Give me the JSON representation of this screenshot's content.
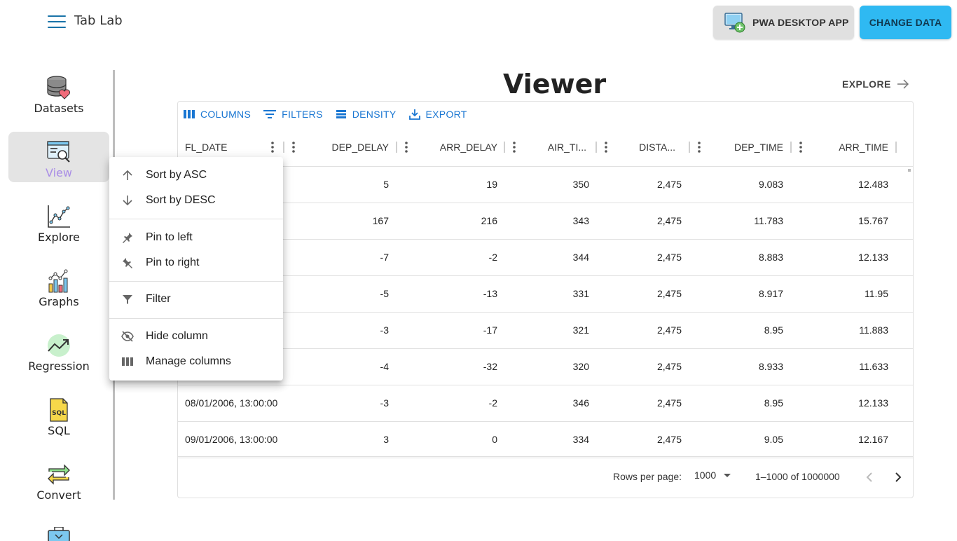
{
  "app": {
    "title": "Tab Lab"
  },
  "header": {
    "pwa_label": "PWA DESKTOP APP",
    "change_label": "CHANGE DATA"
  },
  "sidebar": {
    "items": [
      {
        "label": "Datasets",
        "icon": "database-heart-icon",
        "active": false
      },
      {
        "label": "View",
        "icon": "monitor-search-icon",
        "active": true
      },
      {
        "label": "Explore",
        "icon": "line-chart-icon",
        "active": false
      },
      {
        "label": "Graphs",
        "icon": "bar-chart-icon",
        "active": false
      },
      {
        "label": "Regression",
        "icon": "trend-arrow-icon",
        "active": false
      },
      {
        "label": "SQL",
        "icon": "sql-file-icon",
        "active": false
      },
      {
        "label": "Convert",
        "icon": "convert-arrows-icon",
        "active": false
      }
    ]
  },
  "main": {
    "title": "Viewer",
    "explore_link": "EXPLORE"
  },
  "toolbar": {
    "columns": "COLUMNS",
    "filters": "FILTERS",
    "density": "DENSITY",
    "export": "EXPORT"
  },
  "table": {
    "columns": [
      "FL_DATE",
      "DEP_DELAY",
      "ARR_DELAY",
      "AIR_TI...",
      "DISTA...",
      "DEP_TIME",
      "ARR_TIME"
    ],
    "rows": [
      [
        "",
        "5",
        "19",
        "350",
        "2,475",
        "9.083",
        "12.483"
      ],
      [
        "",
        "167",
        "216",
        "343",
        "2,475",
        "11.783",
        "15.767"
      ],
      [
        "",
        "-7",
        "-2",
        "344",
        "2,475",
        "8.883",
        "12.133"
      ],
      [
        "",
        "-5",
        "-13",
        "331",
        "2,475",
        "8.917",
        "11.95"
      ],
      [
        "",
        "-3",
        "-17",
        "321",
        "2,475",
        "8.95",
        "11.883"
      ],
      [
        "",
        "-4",
        "-32",
        "320",
        "2,475",
        "8.933",
        "11.633"
      ],
      [
        "08/01/2006, 13:00:00",
        "-3",
        "-2",
        "346",
        "2,475",
        "8.95",
        "12.133"
      ],
      [
        "09/01/2006, 13:00:00",
        "3",
        "0",
        "334",
        "2,475",
        "9.05",
        "12.167"
      ]
    ]
  },
  "pagination": {
    "rows_per_page_label": "Rows per page:",
    "rows_per_page_value": "1000",
    "range_text": "1–1000 of 1000000"
  },
  "column_menu": {
    "items": [
      {
        "label": "Sort by ASC",
        "icon": "arrow-up-icon"
      },
      {
        "label": "Sort by DESC",
        "icon": "arrow-down-icon"
      },
      {
        "label": "Pin to left",
        "icon": "pin-left-icon"
      },
      {
        "label": "Pin to right",
        "icon": "pin-right-icon"
      },
      {
        "label": "Filter",
        "icon": "filter-icon"
      },
      {
        "label": "Hide column",
        "icon": "eye-off-icon"
      },
      {
        "label": "Manage columns",
        "icon": "columns-icon"
      }
    ]
  },
  "colors": {
    "accent_blue": "#1976d2",
    "change_button": "#2fb9f2",
    "active_label": "#a98de6"
  }
}
